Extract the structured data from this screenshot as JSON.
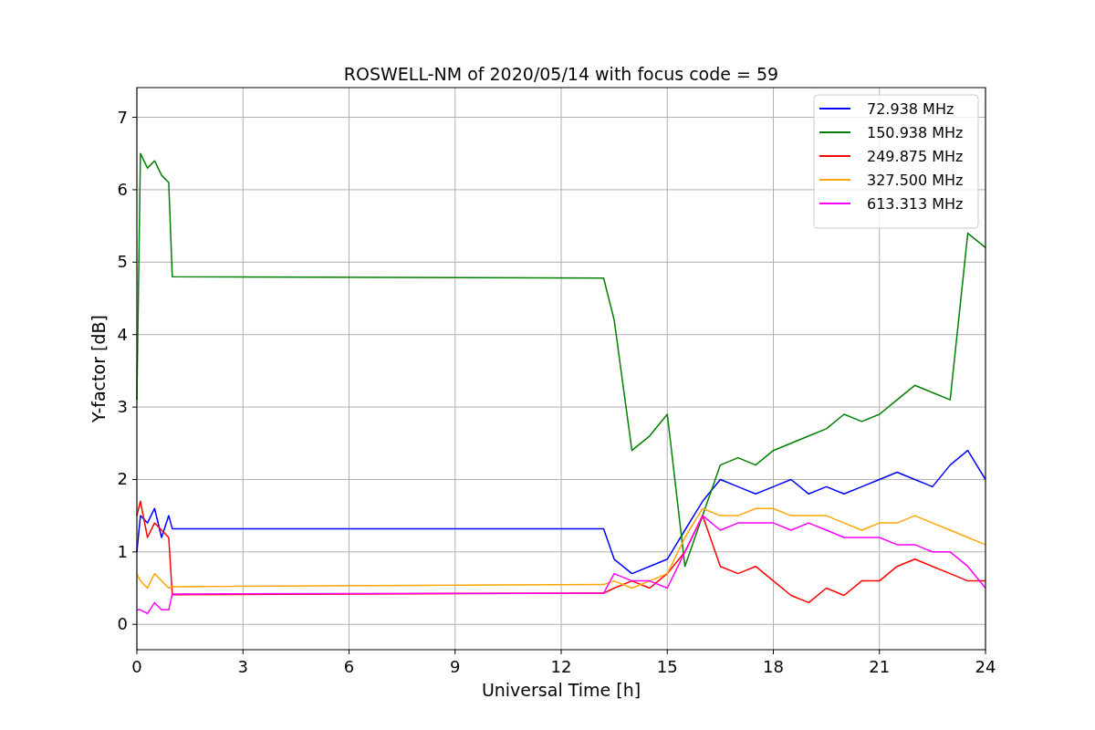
{
  "figure": {
    "chart_data": {
      "type": "line",
      "title": "ROSWELL-NM of 2020/05/14 with focus code = 59",
      "xlabel": "Universal Time [h]",
      "ylabel": "Y-factor [dB]",
      "x": [
        0,
        0.1,
        0.3,
        0.5,
        0.7,
        0.9,
        1.0,
        13.2,
        13.5,
        14,
        14.5,
        15,
        15.5,
        16,
        16.5,
        17,
        17.5,
        18,
        18.5,
        19,
        19.5,
        20,
        20.5,
        21,
        21.5,
        22,
        22.5,
        23,
        23.5,
        24
      ],
      "series": [
        {
          "name": "72.938 MHz",
          "color": "#0000ff",
          "values": [
            1.0,
            1.5,
            1.4,
            1.6,
            1.2,
            1.5,
            1.32,
            1.32,
            0.9,
            0.7,
            0.8,
            0.9,
            1.3,
            1.7,
            2.0,
            1.9,
            1.8,
            1.9,
            2.0,
            1.8,
            1.9,
            1.8,
            1.9,
            2.0,
            2.1,
            2.0,
            1.9,
            2.2,
            2.4,
            2.0
          ]
        },
        {
          "name": "150.938 MHz",
          "color": "#008000",
          "values": [
            3.1,
            6.5,
            6.3,
            6.4,
            6.2,
            6.1,
            4.8,
            4.78,
            4.2,
            2.4,
            2.6,
            2.9,
            0.8,
            1.5,
            2.2,
            2.3,
            2.2,
            2.4,
            2.5,
            2.6,
            2.7,
            2.9,
            2.8,
            2.9,
            3.1,
            3.3,
            3.2,
            3.1,
            5.4,
            5.2
          ]
        },
        {
          "name": "249.875 MHz",
          "color": "#ff0000",
          "values": [
            1.5,
            1.7,
            1.2,
            1.4,
            1.3,
            1.2,
            0.41,
            0.43,
            0.5,
            0.6,
            0.5,
            0.7,
            1.0,
            1.5,
            0.8,
            0.7,
            0.8,
            0.6,
            0.4,
            0.3,
            0.5,
            0.4,
            0.6,
            0.6,
            0.8,
            0.9,
            0.8,
            0.7,
            0.6,
            0.6
          ]
        },
        {
          "name": "327.500 MHz",
          "color": "#ffa500",
          "values": [
            0.7,
            0.6,
            0.5,
            0.7,
            0.6,
            0.5,
            0.52,
            0.55,
            0.6,
            0.5,
            0.6,
            0.7,
            1.2,
            1.6,
            1.5,
            1.5,
            1.6,
            1.6,
            1.5,
            1.5,
            1.5,
            1.4,
            1.3,
            1.4,
            1.4,
            1.5,
            1.4,
            1.3,
            1.2,
            1.1
          ]
        },
        {
          "name": "613.313 MHz",
          "color": "#ff00ff",
          "values": [
            0.2,
            0.2,
            0.15,
            0.3,
            0.2,
            0.2,
            0.42,
            0.43,
            0.7,
            0.6,
            0.6,
            0.5,
            1.0,
            1.5,
            1.3,
            1.4,
            1.4,
            1.4,
            1.3,
            1.4,
            1.3,
            1.2,
            1.2,
            1.2,
            1.1,
            1.1,
            1.0,
            1.0,
            0.8,
            0.5
          ]
        }
      ],
      "xlim": [
        0,
        24
      ],
      "ylim": [
        -0.35,
        7.41
      ],
      "xticks": [
        0,
        3,
        6,
        9,
        12,
        15,
        18,
        21,
        24
      ],
      "yticks": [
        0,
        1,
        2,
        3,
        4,
        5,
        6,
        7
      ],
      "grid": true,
      "legend": true
    }
  }
}
